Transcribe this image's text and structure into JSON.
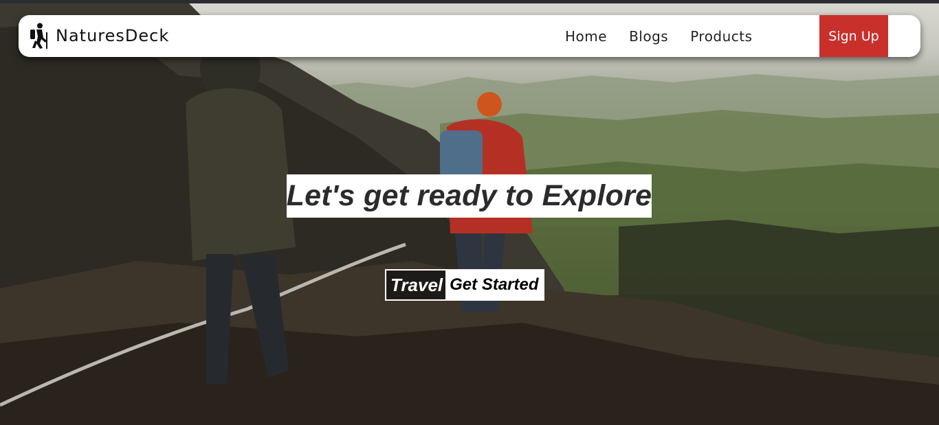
{
  "brand": {
    "name": "NaturesDeck",
    "icon": "hiker-icon"
  },
  "nav": {
    "links": [
      "Home",
      "Blogs",
      "Products"
    ],
    "signup_label": "Sign Up",
    "signup_color": "#c9302c"
  },
  "hero": {
    "headline": "Let's get ready to Explore",
    "cta_travel": "Travel",
    "cta_start": "Get Started"
  }
}
